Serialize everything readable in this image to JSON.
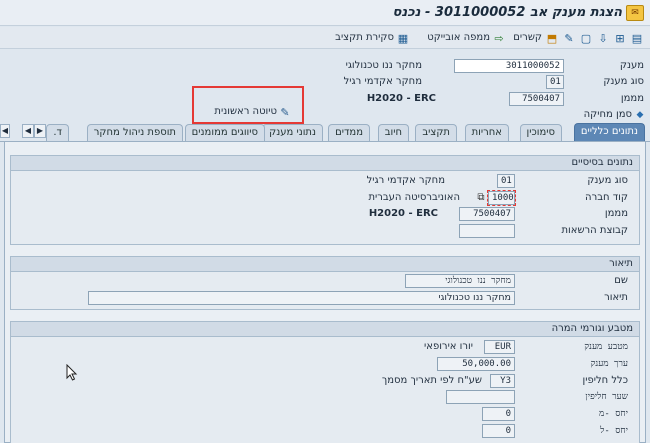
{
  "title_bar": {
    "title": "הצגת מענק אב 3011000052 - נכנס"
  },
  "toolbar": {
    "links_label": "קשרים",
    "object_map_label": "ממפה אובייקט",
    "budget_review_label": "סקירת תקציב"
  },
  "header": {
    "grant_label": "מענק",
    "grant_value": "3011000052",
    "grant_desc": "מחקר ננו טכנולוגי",
    "grant_type_label": "סוג מענק",
    "grant_type_value": "01",
    "grant_type_desc": "מחקר אקדמי רגיל",
    "sponsor_label": "מממן",
    "sponsor_value": "7500407",
    "sponsor_desc": "H2020 - ERC",
    "draft_label": "טיוטה ראשונית",
    "deletion_flag_label": "סמן מחיקה"
  },
  "tabs": [
    {
      "label": "נתונים כלליים",
      "active": true
    },
    {
      "label": "סימוכין"
    },
    {
      "label": "אחריות"
    },
    {
      "label": "תקציב"
    },
    {
      "label": "חיוב"
    },
    {
      "label": "ממדים"
    },
    {
      "label": "נתוני מענק"
    },
    {
      "label": "סיווגים ממומנים"
    },
    {
      "label": "תוספת ניהול מחקר"
    },
    {
      "label": "ד."
    }
  ],
  "basic_data": {
    "title": "נתונים בסיסיים",
    "grant_type_label": "סוג מענק",
    "grant_type_value": "01",
    "grant_type_desc": "מחקר אקדמי רגיל",
    "company_code_label": "קוד חברה",
    "company_code_value": "1000",
    "company_code_desc": "האוניברסיטה העברית",
    "sponsor_label": "מממן",
    "sponsor_value": "7500407",
    "sponsor_desc": "H2020 - ERC",
    "auth_group_label": "קבוצת הרשאות",
    "auth_group_value": ""
  },
  "description": {
    "title": "תיאור",
    "name_label": "שם",
    "name_value": "מחקר ננו טכנולוגי",
    "desc_label": "תיאור",
    "desc_value": "מחקר ננו טכנולוגי"
  },
  "currency": {
    "title": "מטבע וגורמי המרה",
    "currency_label": "מטבע מענק",
    "currency_value": "EUR",
    "currency_desc": "יורו אירופאי",
    "grant_value_label": "ערך מענק",
    "grant_value_value": "50,000.00",
    "rate_rule_label": "כלל חליפין",
    "rate_rule_value": "Y3",
    "rate_rule_desc": "שע\"ח לפי תאריך מסמך",
    "rate_label": "שער חליפין",
    "rate_value": "",
    "ratio_from_label": "יחס -מ",
    "ratio_from_value": "0",
    "ratio_to_label": "יחס -ל",
    "ratio_to_value": "0"
  },
  "colors": {
    "title_bar": "#e8edf3",
    "active_tab": "#5d87b5",
    "highlight_box": "#e53935"
  }
}
